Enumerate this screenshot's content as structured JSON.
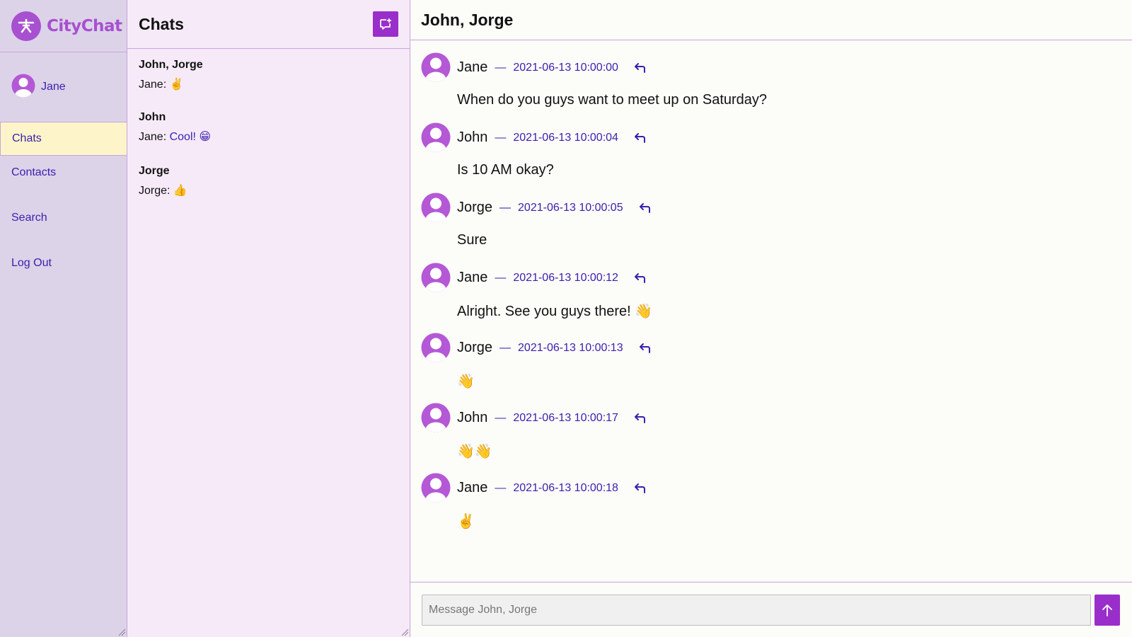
{
  "app": {
    "name": "CityChat"
  },
  "user": {
    "name": "Jane"
  },
  "nav": {
    "items": [
      {
        "label": "Chats",
        "active": true
      },
      {
        "label": "Contacts",
        "active": false
      },
      {
        "label": "Search",
        "active": false
      },
      {
        "label": "Log Out",
        "active": false
      }
    ]
  },
  "chat_list": {
    "title": "Chats",
    "new_chat_icon": "new-chat-icon",
    "chats": [
      {
        "name": "John, Jorge",
        "preview_author": "Jane:",
        "preview_text": "✌️"
      },
      {
        "name": "John",
        "preview_author": "Jane:",
        "preview_text": "Cool! 😁"
      },
      {
        "name": "Jorge",
        "preview_author": "Jorge:",
        "preview_text": "👍"
      }
    ]
  },
  "conversation": {
    "title": "John, Jorge",
    "separator": "—",
    "messages": [
      {
        "author": "Jane",
        "time": "2021-06-13 10:00:00",
        "text": "When do you guys want to meet up on Saturday?"
      },
      {
        "author": "John",
        "time": "2021-06-13 10:00:04",
        "text": "Is 10 AM okay?"
      },
      {
        "author": "Jorge",
        "time": "2021-06-13 10:00:05",
        "text": "Sure"
      },
      {
        "author": "Jane",
        "time": "2021-06-13 10:00:12",
        "text": "Alright. See you guys there! 👋"
      },
      {
        "author": "Jorge",
        "time": "2021-06-13 10:00:13",
        "text": "👋"
      },
      {
        "author": "John",
        "time": "2021-06-13 10:00:17",
        "text": "👋👋"
      },
      {
        "author": "Jane",
        "time": "2021-06-13 10:00:18",
        "text": "✌️"
      }
    ]
  },
  "composer": {
    "placeholder": "Message John, Jorge",
    "value": ""
  },
  "colors": {
    "accent": "#9a2ecb",
    "logo": "#a750d0",
    "link": "#3a1fb0",
    "sidebar_bg": "#dcd3e8",
    "list_bg": "#f6eaf8",
    "active_nav_bg": "#fdf5c9",
    "border": "#c9a4d9"
  }
}
